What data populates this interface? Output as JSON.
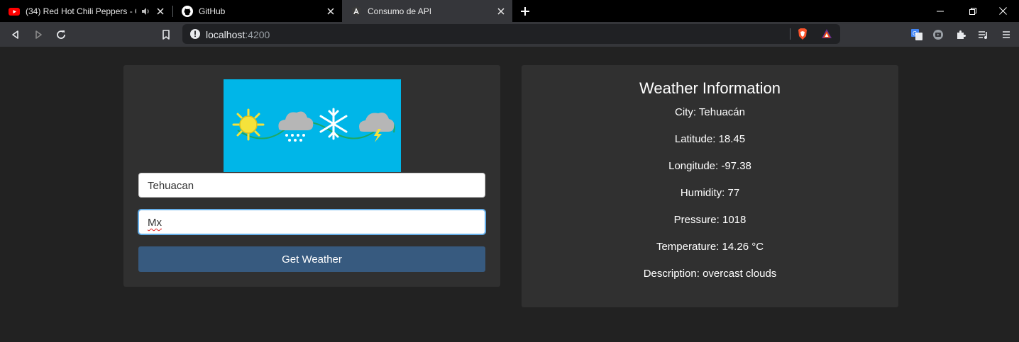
{
  "browser": {
    "tabs": [
      {
        "title": "(34) Red Hot Chili Peppers - O",
        "icon": "youtube-icon",
        "audio_icon": "speaker-icon"
      },
      {
        "title": "GitHub",
        "icon": "github-icon"
      },
      {
        "title": "Consumo de API",
        "icon": "angular-icon",
        "active": true
      }
    ],
    "address": {
      "host": "localhost",
      "port": ":4200"
    }
  },
  "form": {
    "city_value": "Tehuacan",
    "country_value": "Mx",
    "button_label": "Get Weather"
  },
  "weather": {
    "title": "Weather Information",
    "city": "City: Tehuacán",
    "latitude": "Latitude: 18.45",
    "longitude": "Longitude: -97.38",
    "humidity": "Humidity: 77",
    "pressure": "Pressure: 1018",
    "temperature": "Temperature: 14.26 °C",
    "description": "Description: overcast clouds"
  },
  "colors": {
    "page_bg": "#222222",
    "card_bg": "#303030",
    "button_bg": "#375a7f",
    "banner_bg": "#00b6e8"
  }
}
